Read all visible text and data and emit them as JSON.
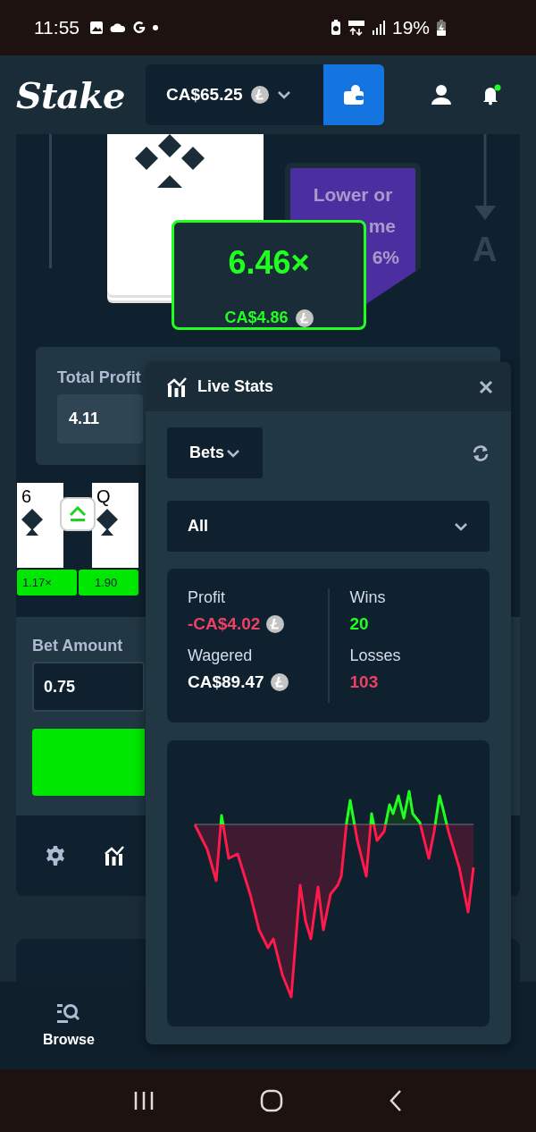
{
  "status_bar": {
    "time": "11:55",
    "battery": "19%"
  },
  "header": {
    "logo": "Stake",
    "balance": "CA$65.25"
  },
  "game": {
    "guess_badge": [
      "Lower or",
      "me",
      "6%"
    ],
    "side_label": "A",
    "multiplier": "6.46×",
    "payout": "CA$4.86"
  },
  "profit": {
    "label": "Total Profit",
    "value": "4.11"
  },
  "history": [
    {
      "rank": "6",
      "multiplier": "1.17×"
    },
    {
      "rank": "Q",
      "multiplier": "1.90"
    }
  ],
  "bet": {
    "label": "Bet Amount",
    "value": "0.75"
  },
  "live_stats": {
    "title": "Live Stats",
    "mode": "Bets",
    "filter": "All",
    "stat_columns": [
      {
        "items": [
          {
            "label": "Profit",
            "value": "-CA$4.02",
            "color": "#ed4163",
            "coin": true
          },
          {
            "label": "Wagered",
            "value": "CA$89.47",
            "color": "#ffffff",
            "coin": true
          }
        ]
      },
      {
        "items": [
          {
            "label": "Wins",
            "value": "20",
            "color": "#1fff20",
            "coin": false
          },
          {
            "label": "Losses",
            "value": "103",
            "color": "#ed4163",
            "coin": false
          }
        ]
      }
    ]
  },
  "bottom_nav": [
    {
      "label": "Browse",
      "selected": true
    }
  ]
}
